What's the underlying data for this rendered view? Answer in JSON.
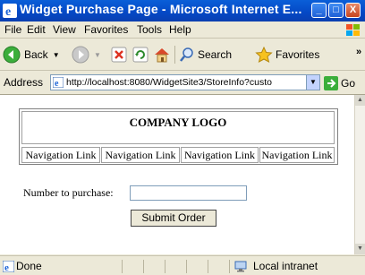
{
  "window": {
    "title": "Widget Purchase Page - Microsoft Internet E...",
    "minimize": "_",
    "maximize": "□",
    "close": "X"
  },
  "menu": {
    "items": [
      "File",
      "Edit",
      "View",
      "Favorites",
      "Tools",
      "Help"
    ]
  },
  "toolbar": {
    "back_label": "Back",
    "search_label": "Search",
    "favorites_label": "Favorites",
    "overflow": "»"
  },
  "address": {
    "label": "Address",
    "url": "http://localhost:8080/WidgetSite3/StoreInfo?custo",
    "go_label": "Go"
  },
  "page": {
    "logo_text": "COMPANY LOGO",
    "nav_links": [
      "Navigation Link",
      "Navigation Link",
      "Navigation Link",
      "Navigation Link"
    ],
    "purchase_label": "Number to purchase:",
    "purchase_value": "",
    "submit_label": "Submit Order"
  },
  "status": {
    "text": "Done",
    "zone": "Local intranet"
  },
  "colors": {
    "titlebar": "#0448c5",
    "chrome": "#ece9d8"
  }
}
